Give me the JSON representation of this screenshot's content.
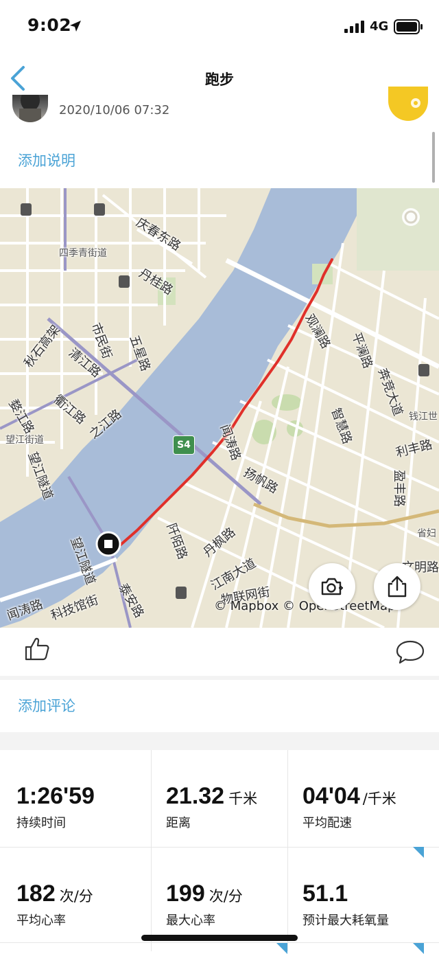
{
  "status_bar": {
    "time": "9:02",
    "network": "4G"
  },
  "nav": {
    "title": "跑步"
  },
  "post": {
    "date": "2020/10/06 07:32",
    "add_description": "添加说明"
  },
  "map": {
    "route_color": "#e0302a",
    "labels": {
      "qingchun_dong": "庆春东路",
      "siji_qing": "四季青街道",
      "dangui": "丹桂路",
      "shimin": "市民街",
      "wuxing": "五星路",
      "qiushi_gaojia": "秋石高架",
      "qingjiang": "清江路",
      "wujiang": "婺江路",
      "qujiang": "衢江路",
      "zhijiang": "之江路",
      "wangjiang_jiedao": "望江街道",
      "wangjiang_suidao_1": "望江隧道",
      "wangjiang_suidao_2": "望江隧道",
      "guanlan": "观澜路",
      "pinglan": "平澜路",
      "bentu": "奔竞大道",
      "qianjiangshi": "钱江世",
      "zhiyuan": "智慧路",
      "wentao": "闻涛路",
      "lifeng": "利丰路",
      "yingfeng": "盈丰路",
      "yangfan": "扬帆路",
      "sheng": "省妇",
      "wenming": "文明路",
      "qianyang": "阡陌路",
      "danfeng": "丹枫路",
      "jiangnan": "江南大道",
      "wulian": "物联网街",
      "kejiguan": "科技馆街",
      "wentao_2": "闻涛路",
      "taian": "泰安路",
      "road_badge": "S4"
    },
    "attribution": "© Mapbox © OpenStreetMap"
  },
  "actions": {
    "add_comment": "添加评论"
  },
  "stats": [
    {
      "value": "1:26'59",
      "unit": "",
      "label": "持续时间"
    },
    {
      "value": "21.32",
      "unit": "千米",
      "label": "距离"
    },
    {
      "value": "04'04",
      "unit": "/千米",
      "label": "平均配速"
    },
    {
      "value": "182",
      "unit": "次/分",
      "label": "平均心率"
    },
    {
      "value": "199",
      "unit": "次/分",
      "label": "最大心率"
    },
    {
      "value": "51.1",
      "unit": "",
      "label": "预计最大耗氧量"
    }
  ],
  "colors": {
    "accent": "#4aa3d6",
    "river": "#a8bcd8",
    "land": "#ebe6d4",
    "badge": "#f4c824"
  }
}
